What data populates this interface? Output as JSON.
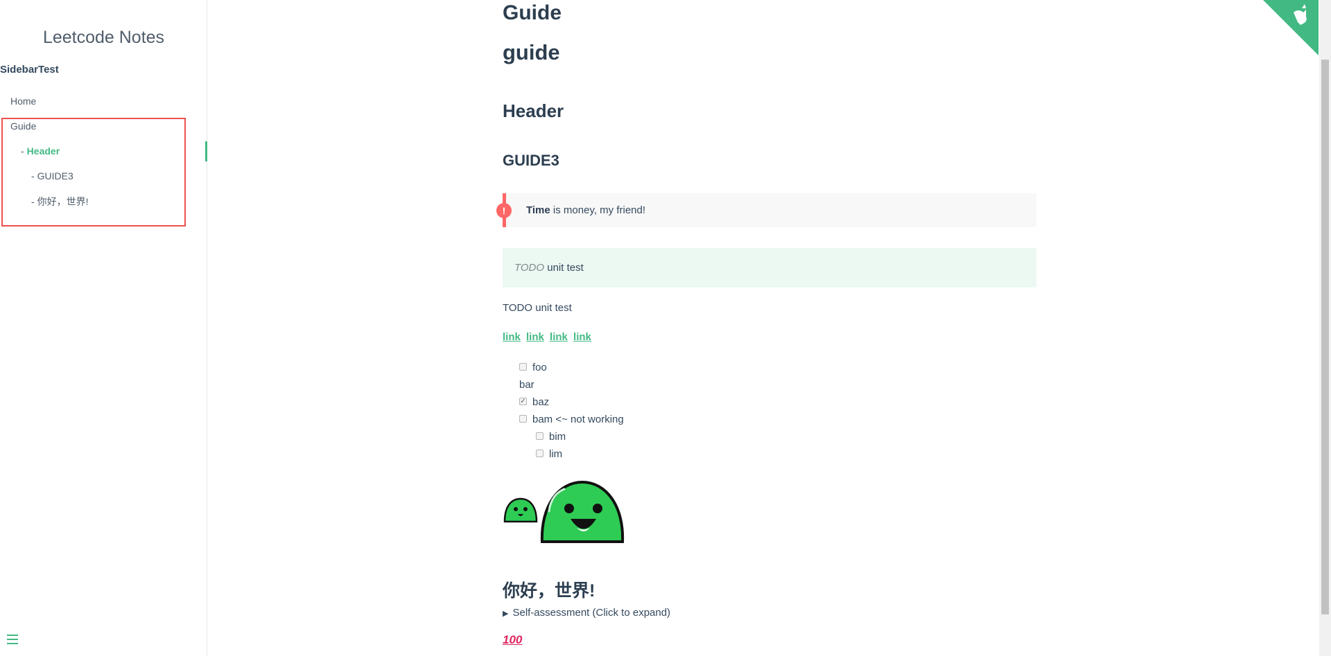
{
  "sidebar": {
    "app_name": "Leetcode Notes",
    "heading": "SidebarTest",
    "items": [
      {
        "label": "Home"
      },
      {
        "label": "Guide"
      },
      {
        "dash": "-",
        "label": "Header"
      },
      {
        "dash": "-",
        "label": "GUIDE3"
      },
      {
        "dash": "-",
        "label": "你好，世界!"
      }
    ]
  },
  "main": {
    "h1a": "Guide",
    "h1b": "guide",
    "h2": "Header",
    "h3": "GUIDE3",
    "tip": {
      "icon": "!",
      "strong": "Time",
      "rest": " is money, my friend!"
    },
    "warn": {
      "em": "TODO",
      "rest": " unit test"
    },
    "para": "TODO unit test",
    "links": [
      "link",
      "link",
      "link",
      "link"
    ],
    "tasks": [
      {
        "label": "foo",
        "checked": false
      },
      {
        "label": "bar"
      },
      {
        "label": "baz",
        "checked": true
      },
      {
        "label": "bam <~ not working",
        "checked": false
      },
      {
        "label": "bim",
        "checked": false
      },
      {
        "label": "lim",
        "checked": false
      }
    ],
    "hello_heading": "你好，世界!",
    "details_summary": "Self-assessment (Click to expand)",
    "emoji_100": "100"
  },
  "colors": {
    "accent": "#42b983",
    "tip_red": "#ff6666",
    "highlight_red": "#ef4f4f"
  }
}
